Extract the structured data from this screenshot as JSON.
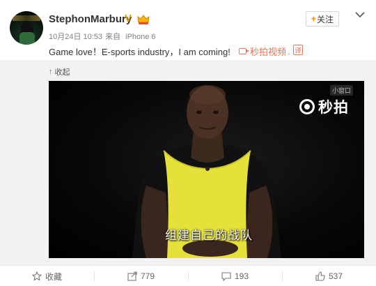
{
  "user": {
    "name": "StephonMarbury",
    "verified_badge": "V",
    "timestamp": "10月24日 10:53",
    "source_prefix": "来自",
    "source_device": "iPhone 6"
  },
  "header": {
    "follow_plus": "+",
    "follow_label": "关注"
  },
  "post": {
    "text": "Game love！E-sports industry，I am coming!",
    "video_link_label": "秒拍视频",
    "video_link_dot": ".",
    "translate_label": "译"
  },
  "media": {
    "collapse_label": "收起",
    "collapse_icon": "↑",
    "mini_window_label": "小窗口",
    "watermark_label": "秒拍",
    "subtitle": "组建自己的战队"
  },
  "footer": {
    "favorite_label": "收藏",
    "repost_count": "779",
    "comment_count": "193",
    "like_count": "537"
  },
  "colors": {
    "accent": "#ff8200",
    "link": "#eb7350",
    "jersey": "#e6e13a"
  }
}
